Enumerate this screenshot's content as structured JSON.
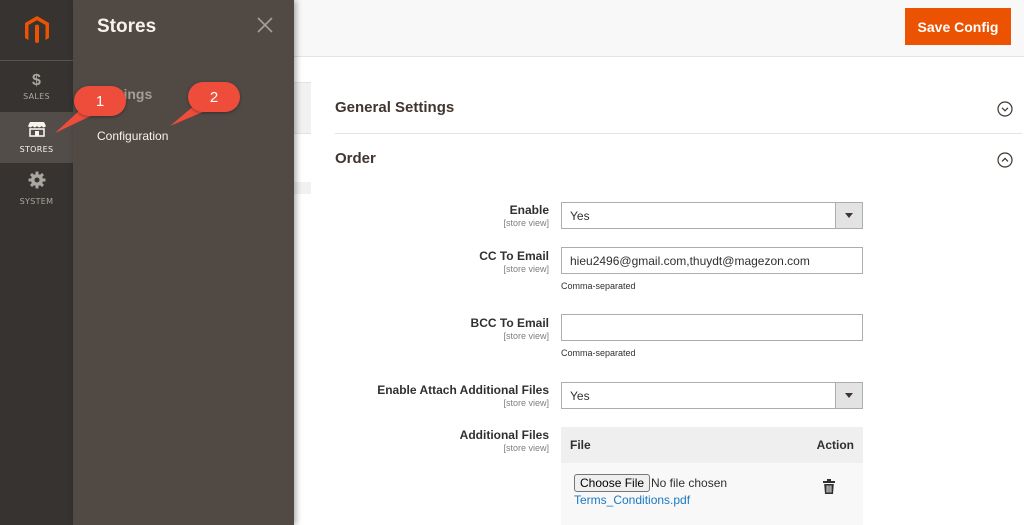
{
  "nav": {
    "items": [
      {
        "label": "SALES",
        "icon": "dollar-icon",
        "glyph": "$"
      },
      {
        "label": "STORES",
        "icon": "storefront-icon"
      },
      {
        "label": "SYSTEM",
        "icon": "gear-icon"
      }
    ]
  },
  "flyout": {
    "title": "Stores",
    "section_heading": "Settings",
    "link": "Configuration"
  },
  "callouts": [
    "1",
    "2"
  ],
  "header": {
    "save_label": "Save Config"
  },
  "sections": {
    "general": {
      "title": "General Settings"
    },
    "order": {
      "title": "Order"
    }
  },
  "fields": {
    "enable": {
      "label": "Enable",
      "scope": "[store view]",
      "value": "Yes"
    },
    "cc": {
      "label": "CC To Email",
      "scope": "[store view]",
      "value": "hieu2496@gmail.com,thuydt@magezon.com",
      "note": "Comma-separated"
    },
    "bcc": {
      "label": "BCC To Email",
      "scope": "[store view]",
      "value": "",
      "note": "Comma-separated"
    },
    "attach": {
      "label": "Enable Attach Additional Files",
      "scope": "[store view]",
      "value": "Yes"
    },
    "files": {
      "label": "Additional Files",
      "scope": "[store view]",
      "col_file": "File",
      "col_action": "Action",
      "choose_label": "Choose File",
      "no_file": "No file chosen",
      "file_name": "Terms_Conditions.pdf"
    }
  },
  "colors": {
    "accent": "#eb5202",
    "callout": "#ef4d3c",
    "rail": "#373330",
    "flyout": "#514943",
    "link": "#1979c3"
  }
}
